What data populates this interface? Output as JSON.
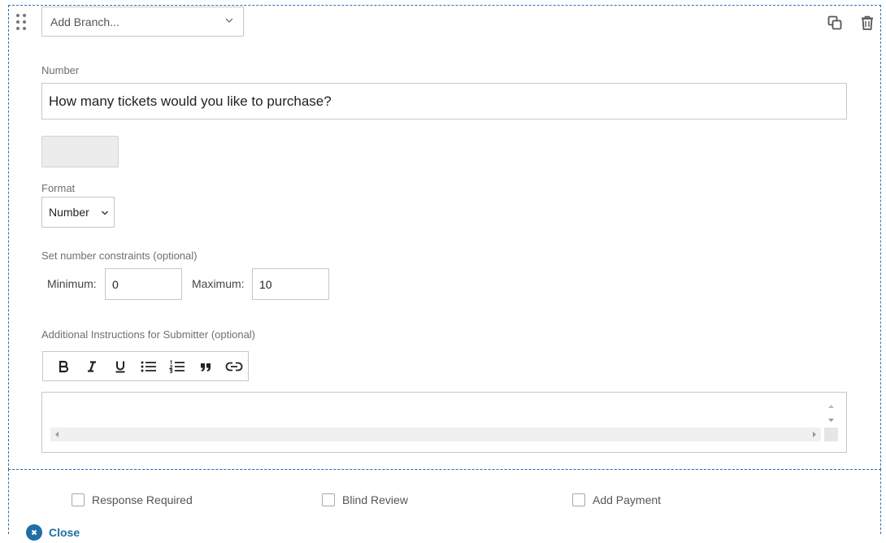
{
  "branch": {
    "value": "Add Branch..."
  },
  "question": {
    "type_label": "Number",
    "text": "How many tickets would you like to purchase?"
  },
  "format": {
    "label": "Format",
    "selected": "Number"
  },
  "constraints": {
    "label": "Set number constraints (optional)",
    "min_label": "Minimum:",
    "min_value": "0",
    "max_label": "Maximum:",
    "max_value": "10"
  },
  "instructions": {
    "label": "Additional Instructions for Submitter (optional)"
  },
  "toolbar": {
    "items": [
      "bold-icon",
      "italic-icon",
      "underline-icon",
      "bulleted-list-icon",
      "numbered-list-icon",
      "quote-icon",
      "link-icon"
    ]
  },
  "options": {
    "response_required": "Response Required",
    "blind_review": "Blind Review",
    "add_payment": "Add Payment"
  },
  "close": {
    "label": "Close"
  },
  "colors": {
    "accent": "#1e6fa8",
    "border": "#c7c7c7",
    "dashed": "#2a6fb0"
  }
}
